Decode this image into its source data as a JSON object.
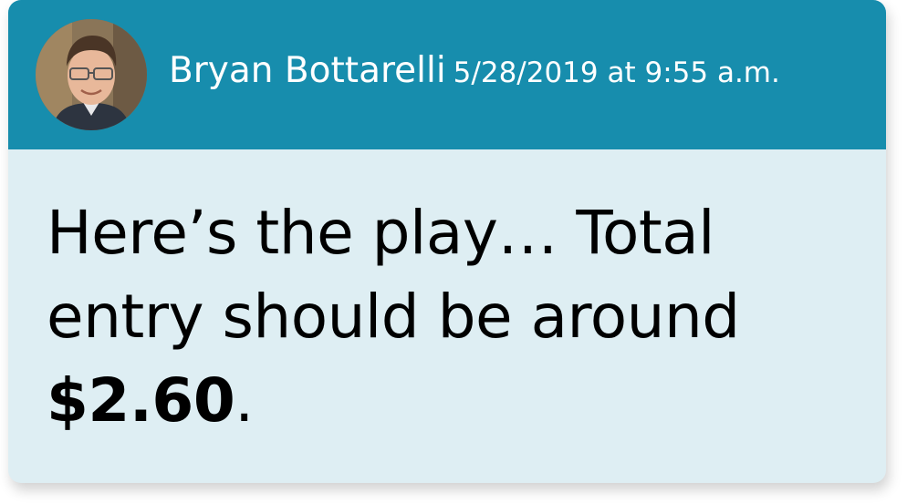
{
  "post": {
    "author_name": "Bryan Bottarelli",
    "timestamp": "5/28/2019 at 9:55 a.m.",
    "avatar_icon": "author-avatar-photo",
    "message": {
      "line1": "Here’s the play… Total",
      "line2": "entry should be around",
      "amount": "$2.60",
      "suffix": "."
    }
  },
  "colors": {
    "header_bg": "#178dad",
    "body_bg": "#deeef3",
    "header_text": "#ffffff",
    "body_text": "#000000"
  }
}
